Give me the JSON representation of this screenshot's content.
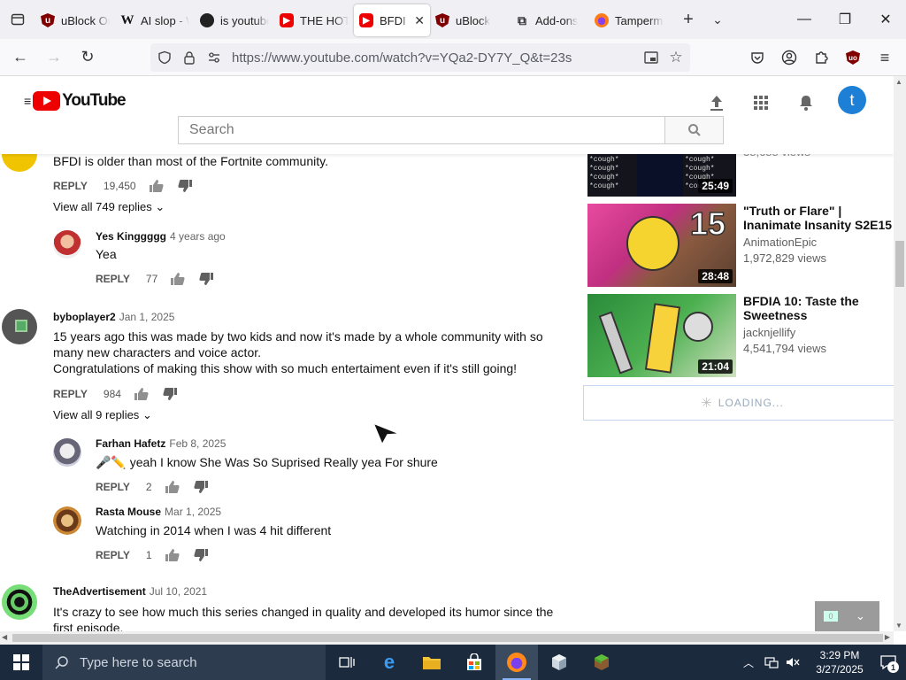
{
  "tabs": [
    {
      "title": "uBlock Origin",
      "icon": "ublock",
      "active": false
    },
    {
      "title": "AI slop - Wikipedia",
      "icon": "wiki",
      "active": false
    },
    {
      "title": "is youtube",
      "icon": "circle",
      "active": false
    },
    {
      "title": "THE HOT",
      "icon": "yt",
      "active": false
    },
    {
      "title": "BFDI",
      "icon": "yt",
      "active": true
    },
    {
      "title": "uBlock",
      "icon": "ublock",
      "active": false
    },
    {
      "title": "Add-ons",
      "icon": "puzzle",
      "active": false
    },
    {
      "title": "Tampermonkey",
      "icon": "ff",
      "active": false
    }
  ],
  "nav": {
    "url": "https://www.youtube.com/watch?v=YQa2-DY7Y_Q&t=23s"
  },
  "youtube": {
    "logo_text": "YouTube",
    "search_placeholder": "Search",
    "avatar_letter": "t"
  },
  "comments": [
    {
      "text": "BFDI is older than most of the Fortnite community.",
      "likes": "19,450",
      "replies_label": "View all 749 replies"
    },
    {
      "author": "Yes Kinggggg",
      "date": "4 years ago",
      "text": "Yea",
      "likes": "77",
      "reply": true
    },
    {
      "author": "byboplayer2",
      "date": "Jan 1, 2025",
      "text": "15 years ago this was made by two kids and now it's made by a whole community with so many new characters and voice actor.\nCongratulations of making this show with so much entertaiment even if it's still going!",
      "likes": "984",
      "replies_label": "View all 9 replies"
    },
    {
      "author": "Farhan Hafetz",
      "date": "Feb 8, 2025",
      "text": "🎤✏️ yeah I know She Was So Suprised Really yea For shure",
      "likes": "2",
      "reply": true
    },
    {
      "author": "Rasta Mouse",
      "date": "Mar 1, 2025",
      "text": "Watching in 2014 when I was 4 hit different",
      "likes": "1",
      "reply": true
    },
    {
      "author": "TheAdvertisement",
      "date": "Jul 10, 2021",
      "text": "It's crazy to see how much this series changed in quality and developed its humor since the first episode."
    }
  ],
  "reply_label": "REPLY",
  "sidebar": [
    {
      "duration": "25:49",
      "views": "38,688 views"
    },
    {
      "title": "\"Truth or Flare\" | Inanimate Insanity S2E15",
      "channel": "AnimationEpic",
      "views": "1,972,829 views",
      "duration": "28:48"
    },
    {
      "title": "BFDIA 10: Taste the Sweetness",
      "channel": "jacknjellify",
      "views": "4,541,794 views",
      "duration": "21:04"
    }
  ],
  "loading_label": "LOADING...",
  "cough_text": "*cough* *cough* *cough* *cough*",
  "taskbar": {
    "search_placeholder": "Type here to search",
    "time": "3:29 PM",
    "date": "3/27/2025",
    "notif_count": "1"
  },
  "mini_player_count": "0"
}
